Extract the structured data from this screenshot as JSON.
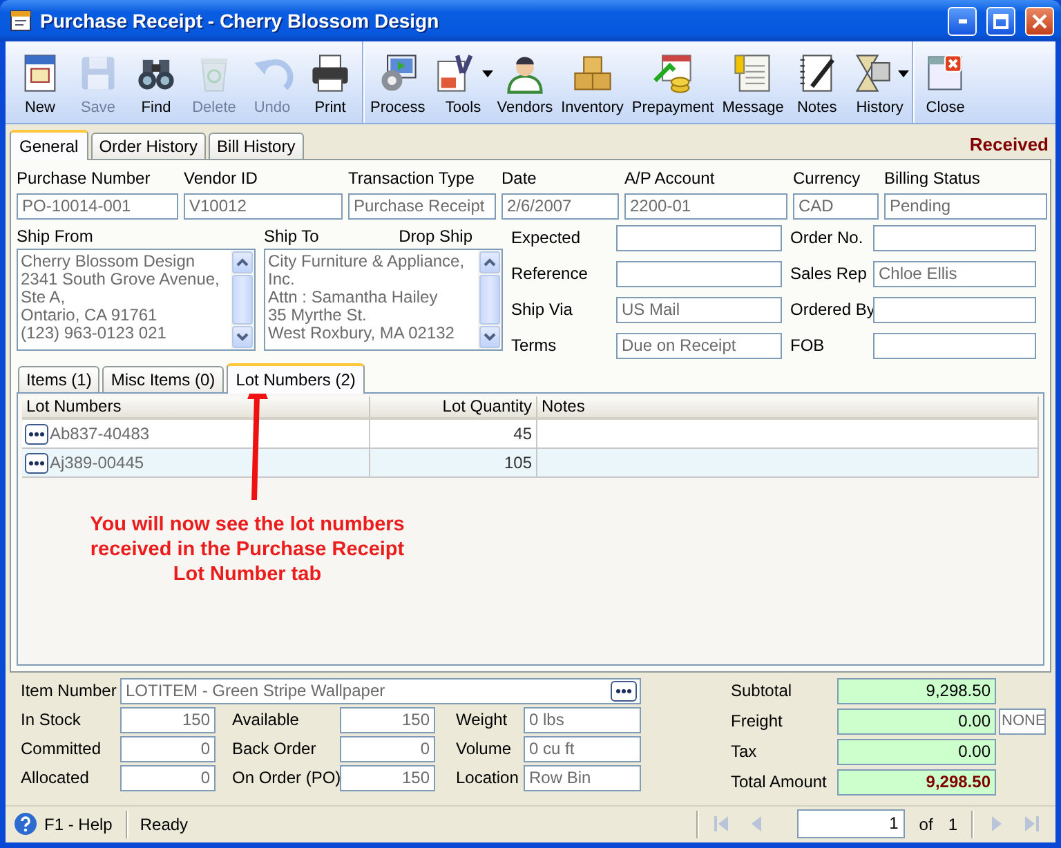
{
  "window": {
    "title": "Purchase Receipt - Cherry Blossom Design"
  },
  "toolbar": {
    "groups": [
      {
        "buttons": [
          {
            "label": "New",
            "disabled": false
          },
          {
            "label": "Save",
            "disabled": true
          },
          {
            "label": "Find",
            "disabled": false
          },
          {
            "label": "Delete",
            "disabled": true
          },
          {
            "label": "Undo",
            "disabled": true
          },
          {
            "label": "Print",
            "disabled": false
          }
        ]
      },
      {
        "buttons": [
          {
            "label": "Process",
            "disabled": false
          },
          {
            "label": "Tools",
            "disabled": false,
            "dropdown": true
          },
          {
            "label": "Vendors",
            "disabled": false
          },
          {
            "label": "Inventory",
            "disabled": false
          },
          {
            "label": "Prepayment",
            "disabled": false
          },
          {
            "label": "Message",
            "disabled": false
          },
          {
            "label": "Notes",
            "disabled": false
          },
          {
            "label": "History",
            "disabled": false,
            "dropdown": true
          }
        ]
      },
      {
        "buttons": [
          {
            "label": "Close",
            "disabled": false
          }
        ]
      }
    ]
  },
  "document_tabs": [
    {
      "label": "General",
      "selected": true
    },
    {
      "label": "Order History",
      "selected": false
    },
    {
      "label": "Bill History",
      "selected": false
    }
  ],
  "status": "Received",
  "header_fields": [
    {
      "label": "Purchase Number",
      "value": "PO-10014-001"
    },
    {
      "label": "Vendor ID",
      "value": "V10012"
    },
    {
      "label": "Transaction Type",
      "value": "Purchase Receipt"
    },
    {
      "label": "Date",
      "value": "2/6/2007"
    },
    {
      "label": "A/P Account",
      "value": "2200-01"
    },
    {
      "label": "Currency",
      "value": "CAD"
    },
    {
      "label": "Billing Status",
      "value": "Pending"
    }
  ],
  "ship_from": {
    "label": "Ship From",
    "lines": [
      "Cherry Blossom Design",
      "2341 South Grove Avenue,",
      "Ste A,",
      "Ontario, CA 91761",
      "(123) 963-0123 021"
    ]
  },
  "ship_to": {
    "label": "Ship To",
    "drop_ship_label": "Drop Ship",
    "lines": [
      "City Furniture & Appliance,",
      "Inc.",
      "Attn : Samantha Hailey",
      "35 Myrthe St.",
      "West Roxbury, MA 02132"
    ]
  },
  "side_fields": [
    {
      "label": "Expected"
    },
    {
      "label": "Order No."
    },
    {
      "label": "Reference"
    },
    {
      "label": "Sales Rep",
      "value": "Chloe Ellis"
    },
    {
      "label": "Ship Via",
      "value": "US Mail"
    },
    {
      "label": "Ordered By"
    },
    {
      "label": "Terms",
      "value": "Due on Receipt"
    },
    {
      "label": "FOB"
    }
  ],
  "detail_tabs": [
    {
      "label": "Items (1)",
      "selected": false
    },
    {
      "label": "Misc Items (0)",
      "selected": false
    },
    {
      "label": "Lot Numbers (2)",
      "selected": true
    }
  ],
  "lot_grid": {
    "columns": [
      "Lot Numbers",
      "Lot Quantity",
      "Notes"
    ],
    "rows": [
      {
        "lot": "Ab837-40483",
        "quantity": "45",
        "selected": false
      },
      {
        "lot": "Aj389-00445",
        "quantity": "105",
        "selected": true
      }
    ]
  },
  "annotation": {
    "lines": [
      "You will now see the lot numbers",
      "received in the Purchase Receipt",
      "Lot Number tab"
    ]
  },
  "item": {
    "label": "Item Number",
    "value": "LOTITEM - Green Stripe Wallpaper"
  },
  "stock_fields": [
    {
      "label": "In Stock",
      "value": "150",
      "kind": "number"
    },
    {
      "label": "Available",
      "value": "150",
      "kind": "number"
    },
    {
      "label": "Weight",
      "value": "0 lbs",
      "kind": "text"
    },
    {
      "label": "Committed",
      "value": "0",
      "kind": "number"
    },
    {
      "label": "Back Order",
      "value": "0",
      "kind": "number"
    },
    {
      "label": "Volume",
      "value": "0 cu ft",
      "kind": "text"
    },
    {
      "label": "Allocated",
      "value": "0",
      "kind": "number"
    },
    {
      "label": "On Order (PO)",
      "value": "150",
      "kind": "number"
    },
    {
      "label": "Location",
      "value": "Row  Bin",
      "kind": "text"
    }
  ],
  "totals": [
    {
      "label": "Subtotal",
      "value": "9,298.50",
      "kind": "line"
    },
    {
      "label": "Freight",
      "value": "0.00",
      "code": "NONE",
      "kind": "line"
    },
    {
      "label": "Tax",
      "value": "0.00",
      "kind": "line"
    },
    {
      "label": "Total Amount",
      "value": "9,298.50",
      "kind": "grand"
    }
  ],
  "status_bar": {
    "help": "F1 - Help",
    "message": "Ready",
    "page": "1",
    "of": "of",
    "pages": "1",
    "navigation_enabled": false
  }
}
